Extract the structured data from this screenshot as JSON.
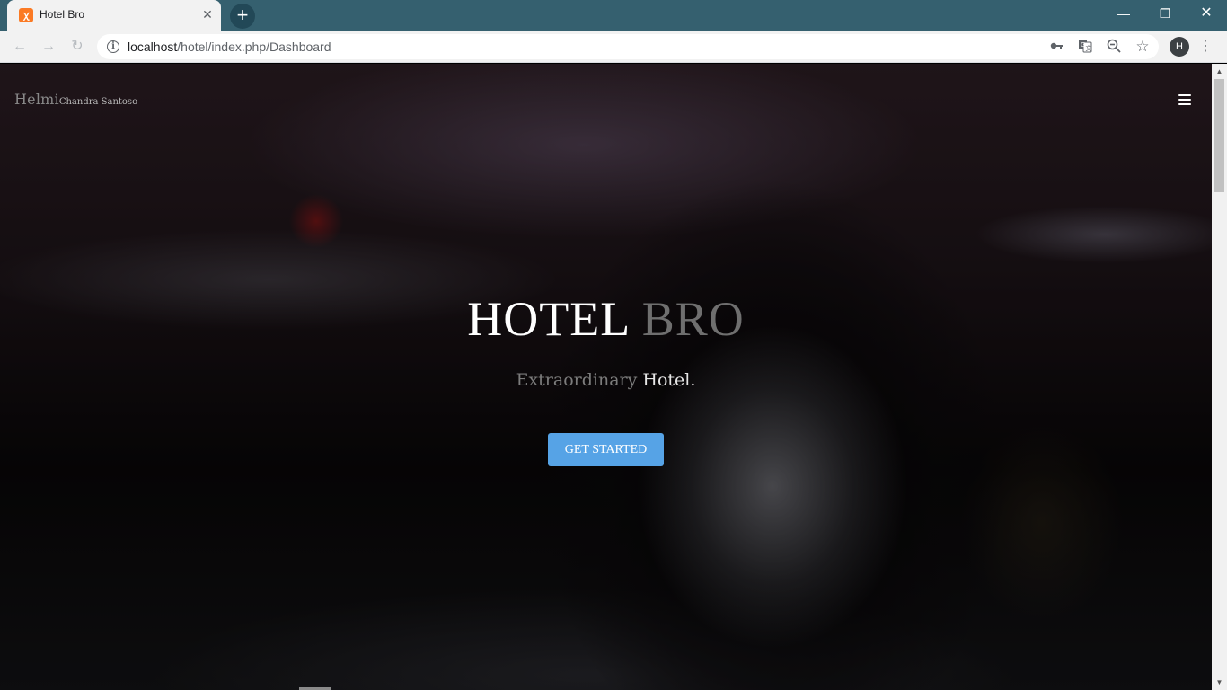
{
  "browser": {
    "tab": {
      "title": "Hotel Bro",
      "favicon": "xampp-icon",
      "close": "✕"
    },
    "new_tab": "+",
    "window": {
      "minimize": "—",
      "maximize": "❐",
      "close": "✕"
    },
    "nav": {
      "back": "←",
      "forward": "→",
      "reload": "↻"
    },
    "address": {
      "host": "localhost",
      "path": "/hotel/index.php/Dashboard"
    },
    "icons": [
      "info-icon",
      "key-icon",
      "translate-icon",
      "zoom-out-icon",
      "star-icon"
    ],
    "profile_initial": "H",
    "menu": "⋮"
  },
  "page": {
    "brand": {
      "first": "Helmi",
      "rest": "Chandra Santoso"
    },
    "hero": {
      "title_main": "HOTEL",
      "title_accent": "BRO",
      "subtitle_light": "Extraordinary",
      "subtitle_strong": "Hotel.",
      "cta_label": "GET STARTED"
    }
  },
  "colors": {
    "tabstrip": "#35606f",
    "cta": "#56a3e6",
    "accent_text": "#6f6f6f"
  }
}
